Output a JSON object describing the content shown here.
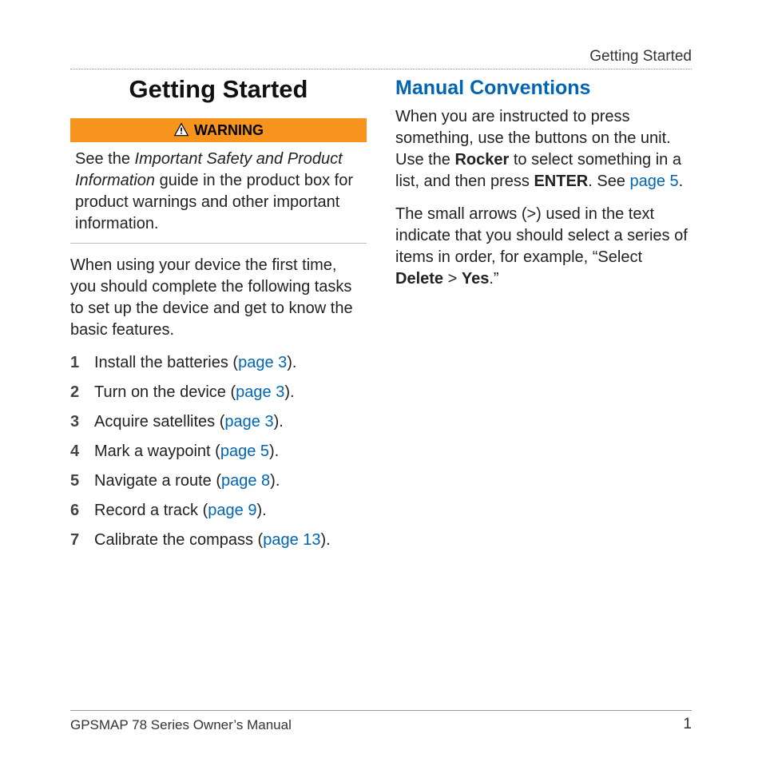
{
  "header_label": "Getting Started",
  "page_title": "Getting Started",
  "warning": {
    "label": "WARNING",
    "text_before": "See the ",
    "italic": "Important Safety and Product Information",
    "text_after": " guide in the product box for product warnings and other important information."
  },
  "intro": "When using your device the first time, you should complete the following tasks to set up the device and get to know the basic features.",
  "steps": [
    {
      "num": "1",
      "text_before": "Install the batteries (",
      "link": "page 3",
      "text_after": ")."
    },
    {
      "num": "2",
      "text_before": "Turn on the device (",
      "link": "page 3",
      "text_after": ")."
    },
    {
      "num": "3",
      "text_before": "Acquire satellites (",
      "link": "page 3",
      "text_after": ")."
    },
    {
      "num": "4",
      "text_before": " Mark a waypoint (",
      "link": "page 5",
      "text_after": ")."
    },
    {
      "num": "5",
      "text_before": "Navigate a route (",
      "link": "page 8",
      "text_after": ")."
    },
    {
      "num": "6",
      "text_before": "Record a track (",
      "link": "page 9",
      "text_after": ")."
    },
    {
      "num": "7",
      "text_before": "Calibrate the compass (",
      "link": "page 13",
      "text_after": ")."
    }
  ],
  "right": {
    "heading": "Manual Conventions",
    "p1_a": "When you are instructed to press something, use the buttons on the unit. Use the ",
    "p1_bold1": "Rocker",
    "p1_b": " to select something in a list, and then press ",
    "p1_bold2": "ENTER",
    "p1_c": ". See ",
    "p1_link": "page 5",
    "p1_d": ".",
    "p2_a": "The small arrows (>) used in the text indicate that you should select a series of items in order, for example, “Select ",
    "p2_bold1": "Delete",
    "p2_b": " > ",
    "p2_bold2": "Yes",
    "p2_c": ".”"
  },
  "footer": {
    "left": "GPSMAP 78 Series Owner’s Manual",
    "right": "1"
  }
}
